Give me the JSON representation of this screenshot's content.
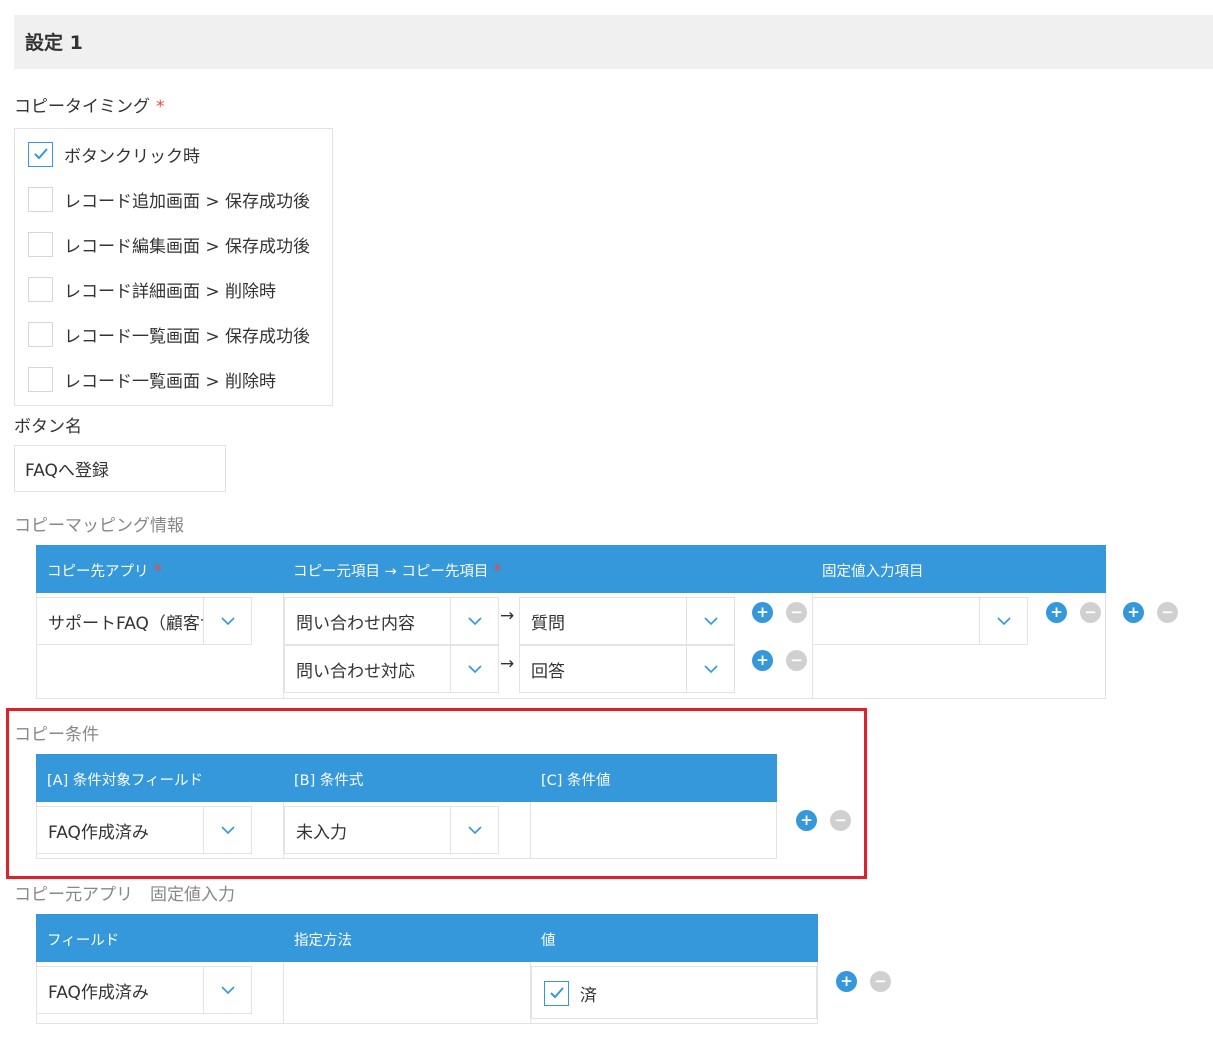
{
  "section": {
    "title": "設定 1"
  },
  "copy_timing": {
    "label": "コピータイミング",
    "required_mark": "*",
    "options": [
      {
        "label": "ボタンクリック時",
        "checked": true
      },
      {
        "label": "レコード追加画面 > 保存成功後",
        "checked": false
      },
      {
        "label": "レコード編集画面 > 保存成功後",
        "checked": false
      },
      {
        "label": "レコード詳細画面 > 削除時",
        "checked": false
      },
      {
        "label": "レコード一覧画面 > 保存成功後",
        "checked": false
      },
      {
        "label": "レコード一覧画面 > 削除時",
        "checked": false
      }
    ]
  },
  "button_name": {
    "label": "ボタン名",
    "value": "FAQへ登録"
  },
  "mapping": {
    "label": "コピーマッピング情報",
    "headers": {
      "dest_app": "コピー先アプリ",
      "copy_items": "コピー元項目 → コピー先項目",
      "fixed": "固定値入力項目",
      "required_mark": "*"
    },
    "dest_app_value": "サポートFAQ（顧客サ",
    "rows": [
      {
        "source": "問い合わせ内容",
        "arrow": "→",
        "target": "質問"
      },
      {
        "source": "問い合わせ対応",
        "arrow": "→",
        "target": "回答"
      }
    ],
    "fixed_value": ""
  },
  "conditions": {
    "label": "コピー条件",
    "headers": {
      "field": "[A] 条件対象フィールド",
      "expr": "[B] 条件式",
      "value": "[C] 条件値"
    },
    "row": {
      "field": "FAQ作成済み",
      "expr": "未入力",
      "value": ""
    }
  },
  "source_fixed": {
    "label": "コピー元アプリ　固定値入力",
    "headers": {
      "field": "フィールド",
      "method": "指定方法",
      "value": "値"
    },
    "row": {
      "field": "FAQ作成済み",
      "method": "",
      "value_label": "済",
      "value_checked": true
    }
  },
  "icons": {
    "add": "+",
    "remove": "−",
    "check": "check-icon",
    "chevron": "chevron-down-icon"
  },
  "colors": {
    "accent": "#3498db",
    "required": "#e74c3c",
    "highlight": "#e0202a"
  }
}
